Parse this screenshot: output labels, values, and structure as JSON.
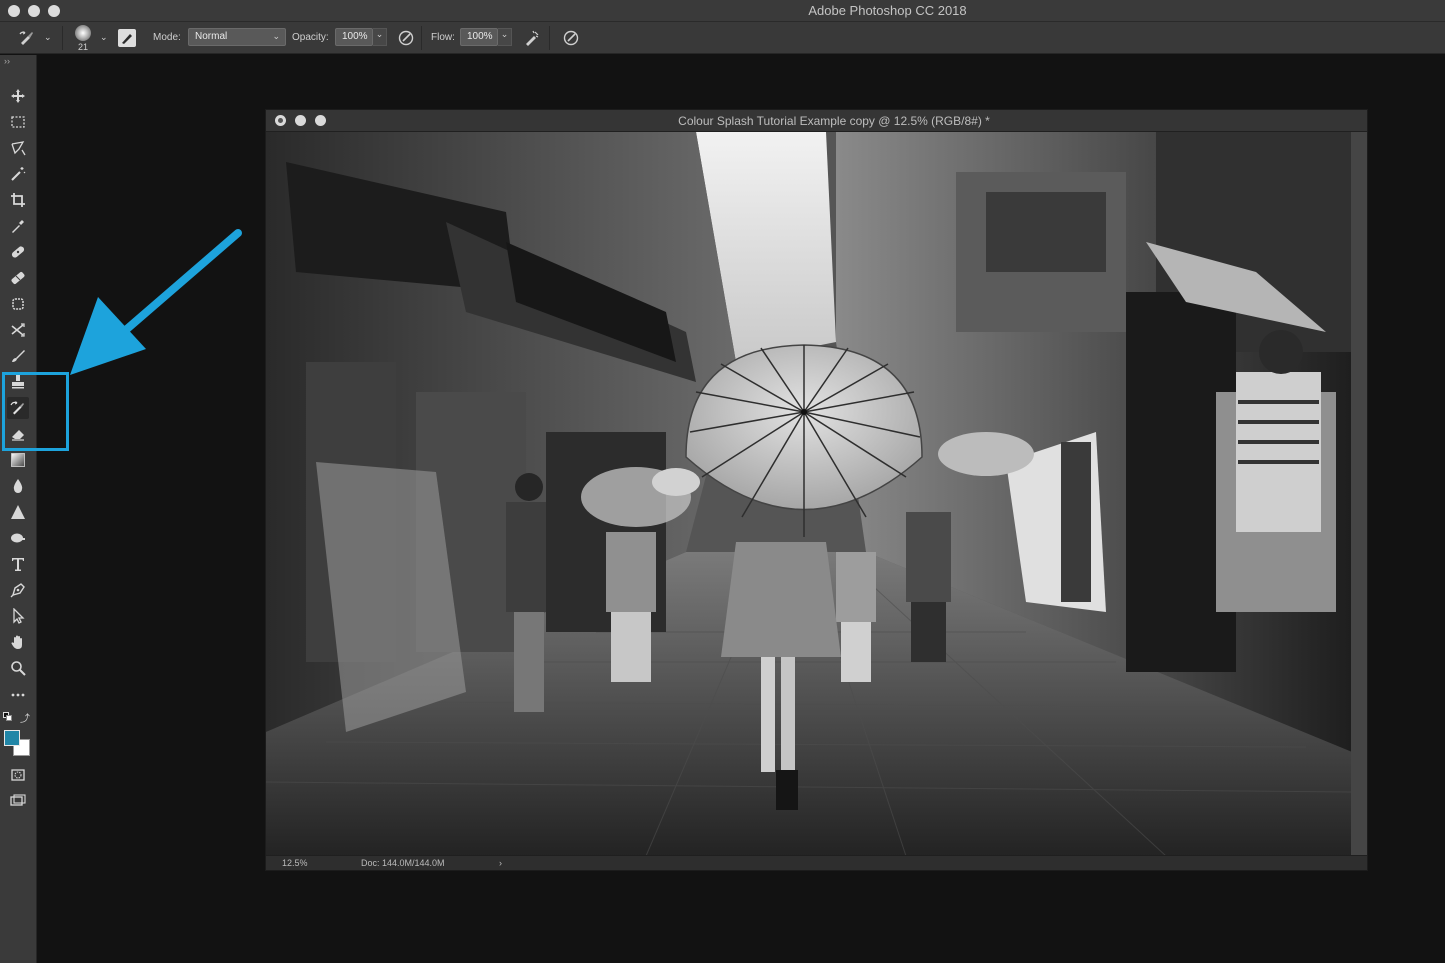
{
  "app": {
    "title": "Adobe Photoshop CC 2018"
  },
  "options_bar": {
    "brush_size": "21",
    "mode_label": "Mode:",
    "mode_value": "Normal",
    "opacity_label": "Opacity:",
    "opacity_value": "100%",
    "flow_label": "Flow:",
    "flow_value": "100%"
  },
  "toolbar": {
    "collapse_glyph": "››",
    "active_tool": "history-brush",
    "highlighted_tools": [
      "clone-stamp",
      "history-brush",
      "eraser"
    ],
    "foreground_color": "#2186a7",
    "background_color": "#ffffff",
    "tools": [
      "move",
      "marquee",
      "lasso",
      "magic-wand",
      "crop",
      "eyedropper",
      "spot-healing",
      "brush-healing",
      "patch",
      "content-aware-move",
      "brush",
      "clone-stamp",
      "history-brush",
      "eraser",
      "gradient",
      "blur",
      "sharpen",
      "dodge",
      "type",
      "pen",
      "path-selection",
      "hand",
      "zoom",
      "more"
    ]
  },
  "annotation": {
    "color": "#1da3dc"
  },
  "document": {
    "title": "Colour Splash Tutorial Example copy @ 12.5% (RGB/8#) *",
    "zoom": "12.5%",
    "doc_size": "Doc: 144.0M/144.0M",
    "status_arrow": "›"
  }
}
